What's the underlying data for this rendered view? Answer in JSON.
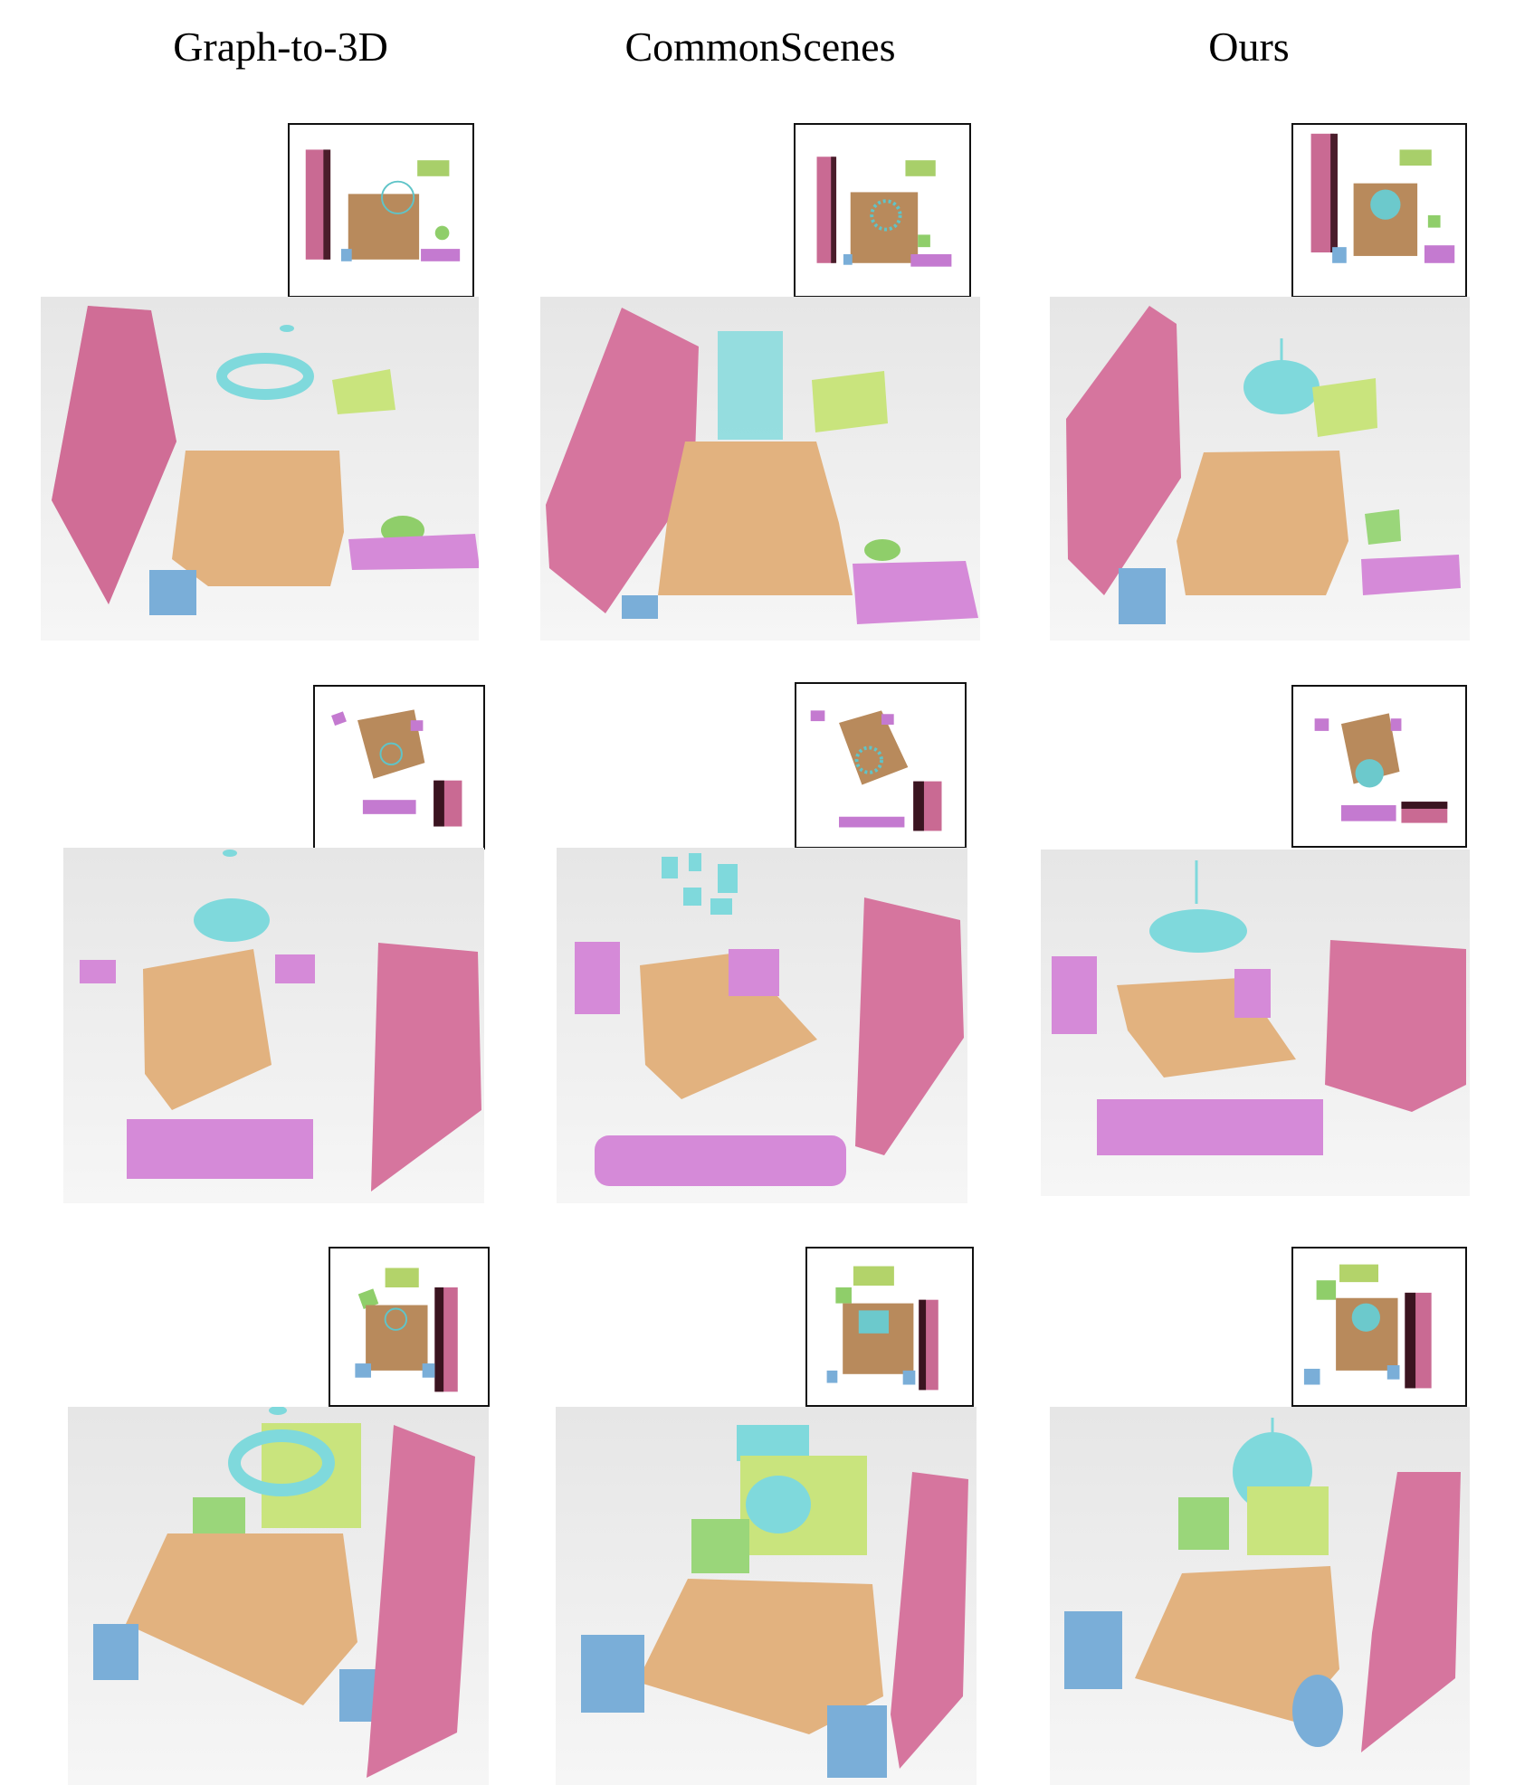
{
  "column_titles": [
    "Graph-to-3D",
    "CommonScenes",
    "Ours"
  ],
  "colors": {
    "wardrobe": "#d6759e",
    "bed": "#e2b27f",
    "lamp": "#7fd9dc",
    "cabinet": "#c9e47d",
    "nightstand_blue": "#7aaed8",
    "table_purple": "#d58ad8",
    "chair_green": "#9ad67a"
  }
}
